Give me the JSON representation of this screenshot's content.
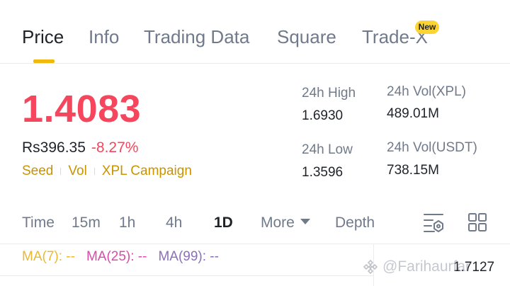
{
  "tabs": [
    {
      "label": "Price"
    },
    {
      "label": "Info"
    },
    {
      "label": "Trading Data"
    },
    {
      "label": "Square"
    },
    {
      "label": "Trade-X"
    }
  ],
  "new_badge": "New",
  "ticker": {
    "price": "1.4083",
    "fiat": "Rs396.35",
    "change": "-8.27%",
    "tags": [
      "Seed",
      "Vol",
      "XPL Campaign"
    ]
  },
  "stats": {
    "high_label": "24h High",
    "high_value": "1.6930",
    "low_label": "24h Low",
    "low_value": "1.3596",
    "vol_base_label": "24h Vol(XPL)",
    "vol_base_value": "489.01M",
    "vol_quote_label": "24h Vol(USDT)",
    "vol_quote_value": "738.15M"
  },
  "intervals": {
    "time": "Time",
    "m15": "15m",
    "h1": "1h",
    "h4": "4h",
    "d1": "1D",
    "more": "More",
    "depth": "Depth"
  },
  "indicators": {
    "ma7": "MA(7): --",
    "ma25": "MA(25): --",
    "ma99": "MA(99): --"
  },
  "axis_value": "1.7127",
  "watermark": "@Farihaurfar",
  "colors": {
    "accent": "#f0b90b",
    "down": "#f6465d",
    "tag": "#c99400"
  }
}
